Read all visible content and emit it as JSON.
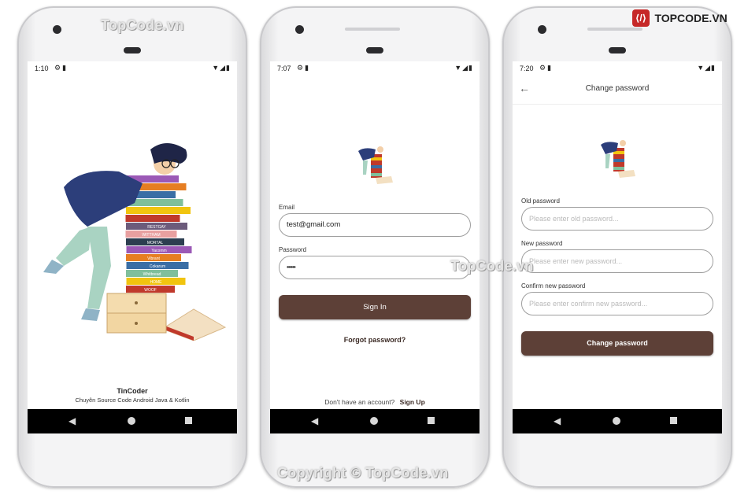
{
  "watermarks": {
    "top_left": "TopCode.vn",
    "middle": "TopCode.vn",
    "bottom": "Copyright © TopCode.vn",
    "brand": "TOPCODE.VN"
  },
  "colors": {
    "primary": "#5d4037",
    "navbar": "#000000",
    "background": "#ffffff"
  },
  "splash": {
    "status_time": "1:10",
    "app_name": "TinCoder",
    "tagline": "Chuyên Source Code Android Java & Kotlin",
    "book_spines": [
      "WOOF",
      "HOME",
      "Whitbread",
      "Cokarum",
      "Vibrant",
      "Yacomm",
      "MORTAL",
      "WITTHAM",
      "RESTGAY"
    ]
  },
  "login": {
    "status_time": "7:07",
    "email_label": "Email",
    "email_value": "test@gmail.com",
    "password_label": "Password",
    "password_value": "••••••",
    "sign_in": "Sign In",
    "forgot": "Forgot password?",
    "no_account": "Don't have an account?",
    "sign_up": "Sign Up"
  },
  "change_password": {
    "status_time": "7:20",
    "title": "Change password",
    "old_label": "Old password",
    "old_placeholder": "Please enter old password...",
    "new_label": "New password",
    "new_placeholder": "Please enter new password...",
    "confirm_label": "Confirm new password",
    "confirm_placeholder": "Please enter confirm new password...",
    "submit": "Change password"
  },
  "icons": [
    "settings-icon",
    "sd-card-icon",
    "wifi-icon",
    "signal-icon",
    "battery-icon",
    "back-arrow-icon",
    "nav-back-icon",
    "nav-home-icon",
    "nav-recents-icon"
  ]
}
